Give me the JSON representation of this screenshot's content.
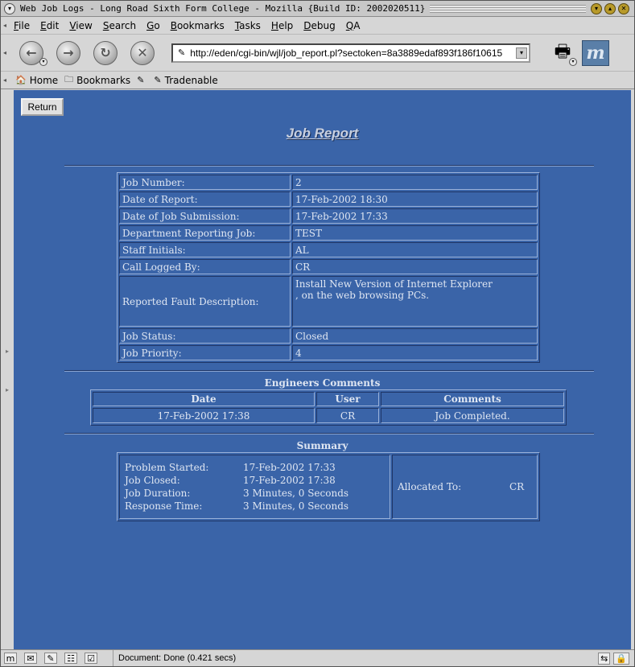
{
  "window": {
    "title": "Web Job Logs - Long Road Sixth Form College - Mozilla {Build ID: 2002020511}"
  },
  "menu": {
    "items": [
      {
        "label": "File",
        "u": "F",
        "rest": "ile"
      },
      {
        "label": "Edit",
        "u": "E",
        "rest": "dit"
      },
      {
        "label": "View",
        "u": "V",
        "rest": "iew"
      },
      {
        "label": "Search",
        "u": "S",
        "rest": "earch"
      },
      {
        "label": "Go",
        "u": "G",
        "rest": "o"
      },
      {
        "label": "Bookmarks",
        "u": "B",
        "rest": "ookmarks"
      },
      {
        "label": "Tasks",
        "u": "T",
        "rest": "asks"
      },
      {
        "label": "Help",
        "u": "H",
        "rest": "elp"
      },
      {
        "label": "Debug",
        "u": "D",
        "rest": "ebug"
      },
      {
        "label": "QA",
        "u": "Q",
        "rest": "A"
      }
    ]
  },
  "nav": {
    "url": "http://eden/cgi-bin/wjl/job_report.pl?sectoken=8a3889edaf893f186f10615"
  },
  "personal_toolbar": {
    "home": "Home",
    "bookmarks": "Bookmarks",
    "tradenable": "Tradenable"
  },
  "page": {
    "return_label": "Return",
    "title": "Job Report",
    "details": {
      "job_number_label": "Job Number:",
      "job_number": "2",
      "date_report_label": "Date of Report:",
      "date_report": "17-Feb-2002 18:30",
      "date_sub_label": "Date of Job Submission:",
      "date_sub": "17-Feb-2002 17:33",
      "dept_label": "Department Reporting Job:",
      "dept": "TEST",
      "staff_label": "Staff Initials:",
      "staff": "AL",
      "logged_label": "Call Logged By:",
      "logged": "CR",
      "fault_label": "Reported Fault Description:",
      "fault_line1": "Install New Version of Internet Explorer",
      "fault_line2": ", on the web browsing PCs.",
      "status_label": "Job Status:",
      "status": "Closed",
      "priority_label": "Job Priority:",
      "priority": "4"
    },
    "engineers": {
      "title": "Engineers Comments",
      "headers": {
        "date": "Date",
        "user": "User",
        "comments": "Comments"
      },
      "row": {
        "date": "17-Feb-2002 17:38",
        "user": "CR",
        "comments": "Job Completed."
      }
    },
    "summary": {
      "title": "Summary",
      "started_label": "Problem Started:",
      "started": "17-Feb-2002 17:33",
      "closed_label": "Job Closed:",
      "closed": "17-Feb-2002 17:38",
      "duration_label": "Job Duration:",
      "duration": "3 Minutes, 0 Seconds",
      "response_label": "Response Time:",
      "response": "3 Minutes, 0 Seconds",
      "allocated_label": "Allocated To:",
      "allocated": "CR"
    }
  },
  "status": {
    "text": "Document: Done (0.421 secs)"
  },
  "colors": {
    "page_background": "#3a64a8",
    "page_text": "#dfe6f2",
    "chrome": "#d6d6d6"
  }
}
